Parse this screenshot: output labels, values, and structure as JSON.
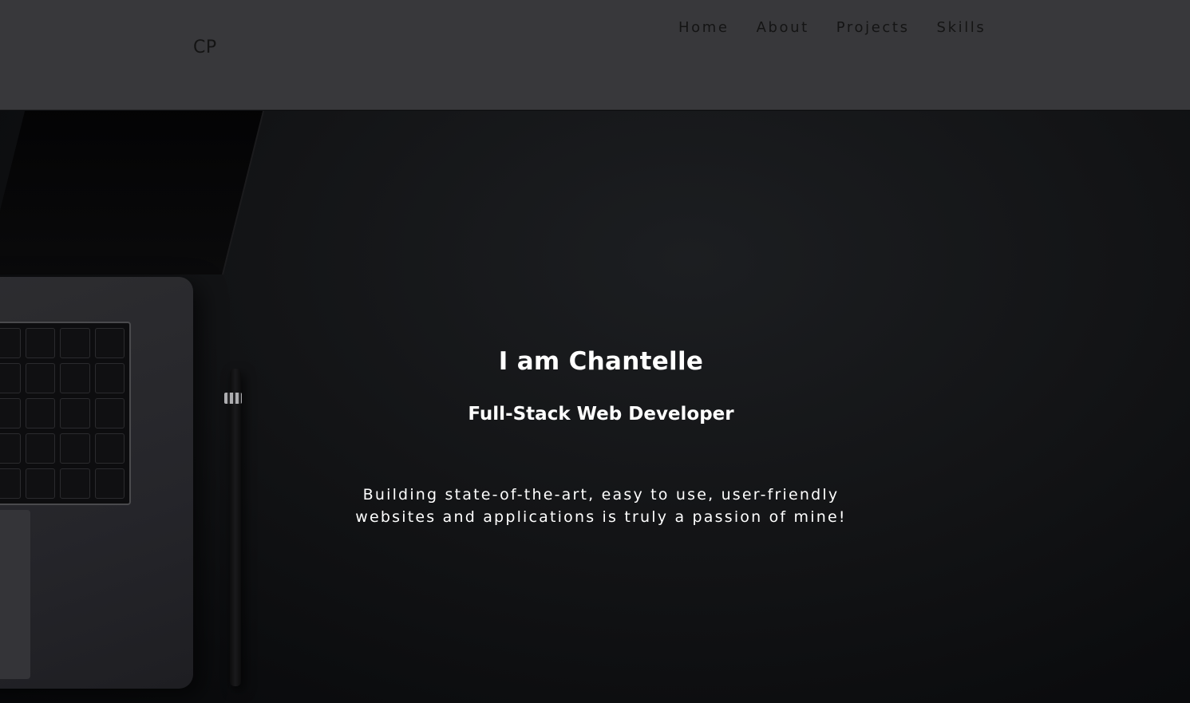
{
  "header": {
    "logo": "CP",
    "nav": [
      {
        "label": "Home"
      },
      {
        "label": "About"
      },
      {
        "label": "Projects"
      },
      {
        "label": "Skills"
      }
    ]
  },
  "hero": {
    "title": "I am Chantelle",
    "subtitle": "Full-Stack Web Developer",
    "tagline_line1": "Building state-of-the-art, easy to use, user-friendly",
    "tagline_line2": "websites and applications is truly a passion of mine!"
  },
  "colors": {
    "header_bg": "#38383b",
    "nav_text": "#141414",
    "hero_bg": "#0b0c0e",
    "hero_text": "#ffffff"
  },
  "icons": [
    "laptop-illustration",
    "pencil-illustration"
  ]
}
